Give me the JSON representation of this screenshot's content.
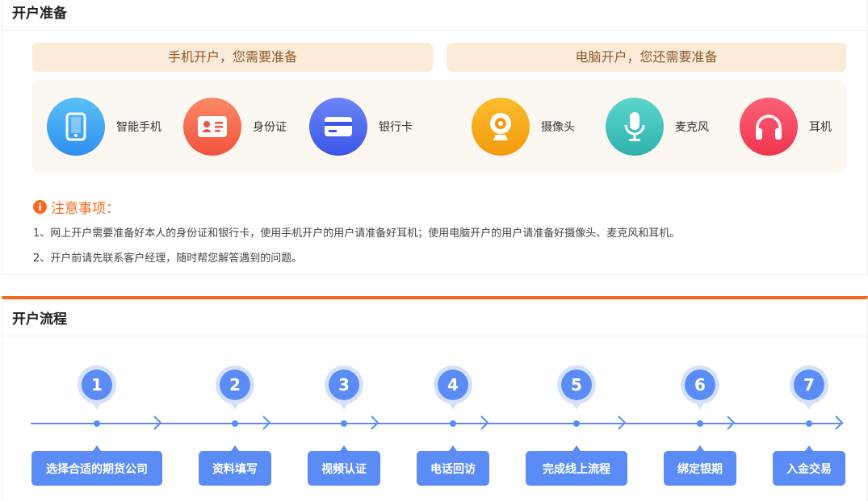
{
  "prep": {
    "title": "开户准备",
    "phone_banner": "手机开户，您需要准备",
    "pc_banner": "电脑开户，您还需要准备",
    "items": [
      {
        "label": "智能手机",
        "icon": "smartphone-icon",
        "color": "#3aa8f0"
      },
      {
        "label": "身份证",
        "icon": "id-card-icon",
        "color": "#f7684a"
      },
      {
        "label": "银行卡",
        "icon": "bank-card-icon",
        "color": "#4a68ef"
      },
      {
        "label": "摄像头",
        "icon": "webcam-icon",
        "color": "#f7a81b"
      },
      {
        "label": "麦克风",
        "icon": "microphone-icon",
        "color": "#3cc3bd"
      },
      {
        "label": "耳机",
        "icon": "headphones-icon",
        "color": "#f5455f"
      }
    ]
  },
  "notice": {
    "title": "注意事项：",
    "lines": [
      "1、网上开户需要准备好本人的身份证和银行卡，使用手机开户的用户请准备好耳机；使用电脑开户的用户请准备好摄像头、麦克风和耳机。",
      "2、开户前请先联系客户经理，随时帮您解答遇到的问题。"
    ]
  },
  "process": {
    "title": "开户流程",
    "steps": [
      {
        "num": "1",
        "label": "选择合适的期货公司"
      },
      {
        "num": "2",
        "label": "资料填写"
      },
      {
        "num": "3",
        "label": "视频认证"
      },
      {
        "num": "4",
        "label": "电话回访"
      },
      {
        "num": "5",
        "label": "完成线上流程"
      },
      {
        "num": "6",
        "label": "绑定银期"
      },
      {
        "num": "7",
        "label": "入金交易"
      }
    ]
  },
  "colors": {
    "accent": "#f36a1f",
    "flow_blue": "#5b8cf5"
  }
}
